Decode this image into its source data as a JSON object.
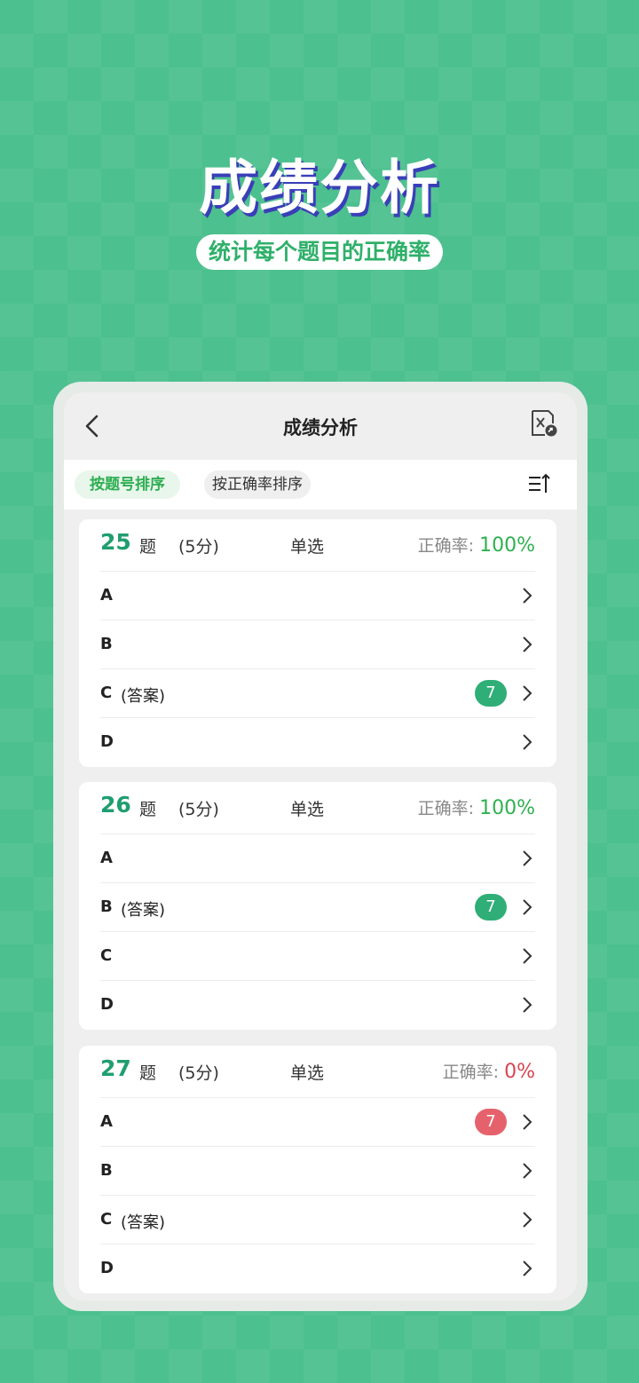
{
  "hero": {
    "title": "成绩分析",
    "subtitle": "统计每个题目的正确率"
  },
  "header": {
    "title": "成绩分析",
    "back_icon": "chevron-left-icon",
    "export_icon": "excel-export-icon"
  },
  "sort": {
    "by_number": "按题号排序",
    "by_accuracy": "按正确率排序",
    "order_icon": "sort-ascending-icon"
  },
  "questions": [
    {
      "number": "25",
      "ti": "题",
      "score": "(5分)",
      "type": "单选",
      "rate_label": "正确率:",
      "rate": "100%",
      "rate_status": "good",
      "options": [
        {
          "letter": "A",
          "note": "",
          "count": ""
        },
        {
          "letter": "B",
          "note": "",
          "count": ""
        },
        {
          "letter": "C",
          "note": "(答案)",
          "count": "7",
          "count_color": "green"
        },
        {
          "letter": "D",
          "note": "",
          "count": ""
        }
      ]
    },
    {
      "number": "26",
      "ti": "题",
      "score": "(5分)",
      "type": "单选",
      "rate_label": "正确率:",
      "rate": "100%",
      "rate_status": "good",
      "options": [
        {
          "letter": "A",
          "note": "",
          "count": ""
        },
        {
          "letter": "B",
          "note": "(答案)",
          "count": "7",
          "count_color": "green"
        },
        {
          "letter": "C",
          "note": "",
          "count": ""
        },
        {
          "letter": "D",
          "note": "",
          "count": ""
        }
      ]
    },
    {
      "number": "27",
      "ti": "题",
      "score": "(5分)",
      "type": "单选",
      "rate_label": "正确率:",
      "rate": "0%",
      "rate_status": "bad",
      "options": [
        {
          "letter": "A",
          "note": "",
          "count": "7",
          "count_color": "red"
        },
        {
          "letter": "B",
          "note": "",
          "count": ""
        },
        {
          "letter": "C",
          "note": "(答案)",
          "count": ""
        },
        {
          "letter": "D",
          "note": "",
          "count": ""
        }
      ]
    }
  ],
  "colors": {
    "background": "#4cc08e",
    "accent_green": "#1f9e70",
    "rate_good": "#2fb04f",
    "rate_bad": "#d94450",
    "badge_green": "#2fae78",
    "badge_red": "#e5626c"
  }
}
